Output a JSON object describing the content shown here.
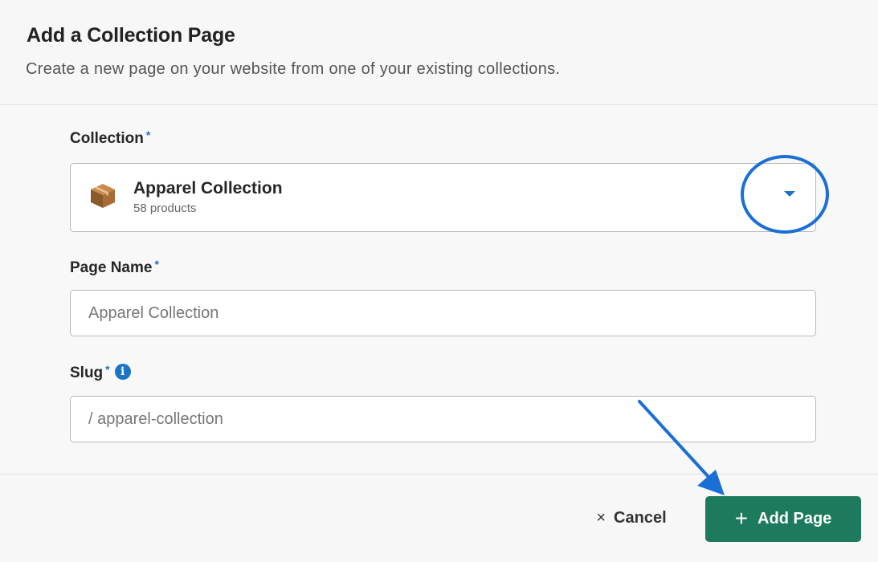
{
  "dialog": {
    "title": "Add a Collection Page",
    "subtitle": "Create a new page on your website from one of your existing collections."
  },
  "collection_field": {
    "label": "Collection",
    "required_marker": "*",
    "selected_name": "Apparel Collection",
    "selected_count": "58 products",
    "icon": "package-box-icon"
  },
  "page_name_field": {
    "label": "Page Name",
    "required_marker": "*",
    "placeholder": "Apparel Collection"
  },
  "slug_field": {
    "label": "Slug",
    "required_marker": "*",
    "info_icon": "i",
    "placeholder": "/ apparel-collection"
  },
  "footer": {
    "cancel_label": "Cancel",
    "cancel_icon": "×",
    "add_label": "Add Page",
    "add_icon": "+"
  },
  "colors": {
    "accent_blue": "#1a73c7",
    "annotation_blue": "#1a6fd6",
    "primary_green": "#1d7a5c"
  }
}
